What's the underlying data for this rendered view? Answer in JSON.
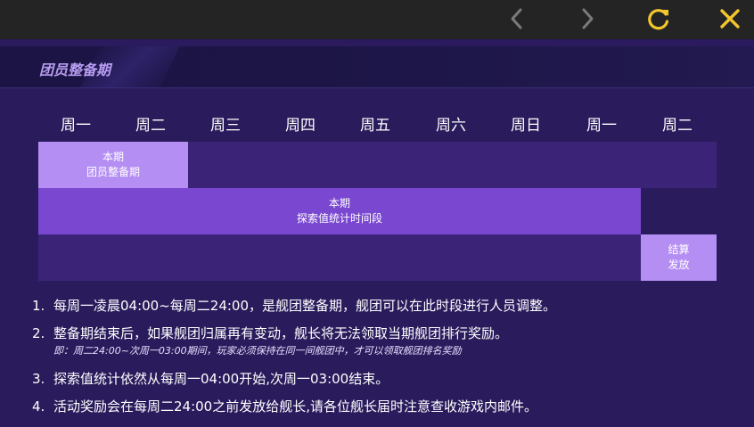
{
  "topbar": {
    "back_icon": "chevron-left-icon",
    "forward_icon": "chevron-right-icon",
    "refresh_icon": "refresh-icon",
    "close_icon": "close-icon",
    "colors": {
      "nav_disabled": "#7a7a7a",
      "accent": "#f2c62c"
    }
  },
  "panel": {
    "title": "团员整备期",
    "days": [
      "周一",
      "周二",
      "周三",
      "周四",
      "周五",
      "周六",
      "周日",
      "周一",
      "周二"
    ],
    "timeline": {
      "row1": {
        "line1": "本期",
        "line2": "团员整备期"
      },
      "row2": {
        "line1": "本期",
        "line2": "探索值统计时间段"
      },
      "row3": {
        "line1": "结算",
        "line2": "发放"
      }
    },
    "notes": [
      {
        "num": "1.",
        "text": "每周一凌晨04:00~每周二24:00，是舰团整备期，舰团可以在此时段进行人员调整。"
      },
      {
        "num": "2.",
        "text": "整备期结束后，如果舰团归属再有变动，舰长将无法领取当期舰团排行奖励。",
        "sub": "即：周二24:00~次周一03:00期间，玩家必须保持在同一间舰团中，才可以领取舰团排名奖励"
      },
      {
        "num": "3.",
        "text": "探索值统计依然从每周一04:00开始,次周一03:00结束。"
      },
      {
        "num": "4.",
        "text": "活动奖励会在每周二24:00之前发放给舰长,请各位舰长届时注意查收游戏内邮件。"
      }
    ],
    "colors": {
      "row_bg": "#3b2478",
      "light_block": "#b48ef2",
      "mid_block": "#7a48d0",
      "title": "#b79cf0"
    }
  }
}
